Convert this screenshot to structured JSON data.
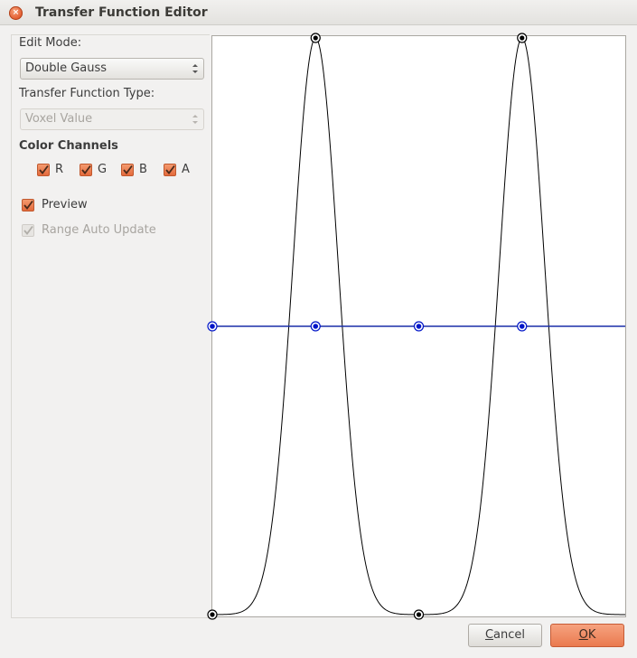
{
  "window": {
    "title": "Transfer Function Editor",
    "close_icon": "×"
  },
  "form": {
    "edit_mode_label": "Edit Mode:",
    "edit_mode_value": "Double Gauss",
    "tf_type_label": "Transfer Function Type:",
    "tf_type_value": "Voxel Value",
    "color_channels_label": "Color Channels",
    "channels": [
      {
        "label": "R",
        "checked": true
      },
      {
        "label": "G",
        "checked": true
      },
      {
        "label": "B",
        "checked": true
      },
      {
        "label": "A",
        "checked": true
      }
    ],
    "preview_label": "Preview",
    "preview_checked": true,
    "range_auto_update_label": "Range Auto Update",
    "range_auto_update_checked": true,
    "range_auto_update_enabled": false
  },
  "buttons": {
    "cancel_label": "Cancel",
    "cancel_mnemonic": "C",
    "ok_label": "OK",
    "ok_mnemonic": "O"
  },
  "colors": {
    "accent": "#e46a3c",
    "curve": "#000000",
    "control_line": "#1a2ea8",
    "control_points": "#0015c8"
  },
  "chart_data": {
    "type": "line",
    "x_range": [
      0,
      1
    ],
    "y_range": [
      0,
      1
    ],
    "series": [
      {
        "role": "double-gaussian curve",
        "peaks": [
          0.25,
          0.75
        ],
        "sigma": 0.055,
        "handles": [
          {
            "x": 0.0,
            "y": 0.0
          },
          {
            "x": 0.25,
            "y": 1.0
          },
          {
            "x": 0.5,
            "y": 0.0
          },
          {
            "x": 0.75,
            "y": 1.0
          }
        ]
      },
      {
        "role": "control line",
        "y": 0.5,
        "handles": [
          {
            "x": 0.0,
            "y": 0.5
          },
          {
            "x": 0.25,
            "y": 0.5
          },
          {
            "x": 0.5,
            "y": 0.5
          },
          {
            "x": 0.75,
            "y": 0.5
          }
        ]
      }
    ]
  }
}
